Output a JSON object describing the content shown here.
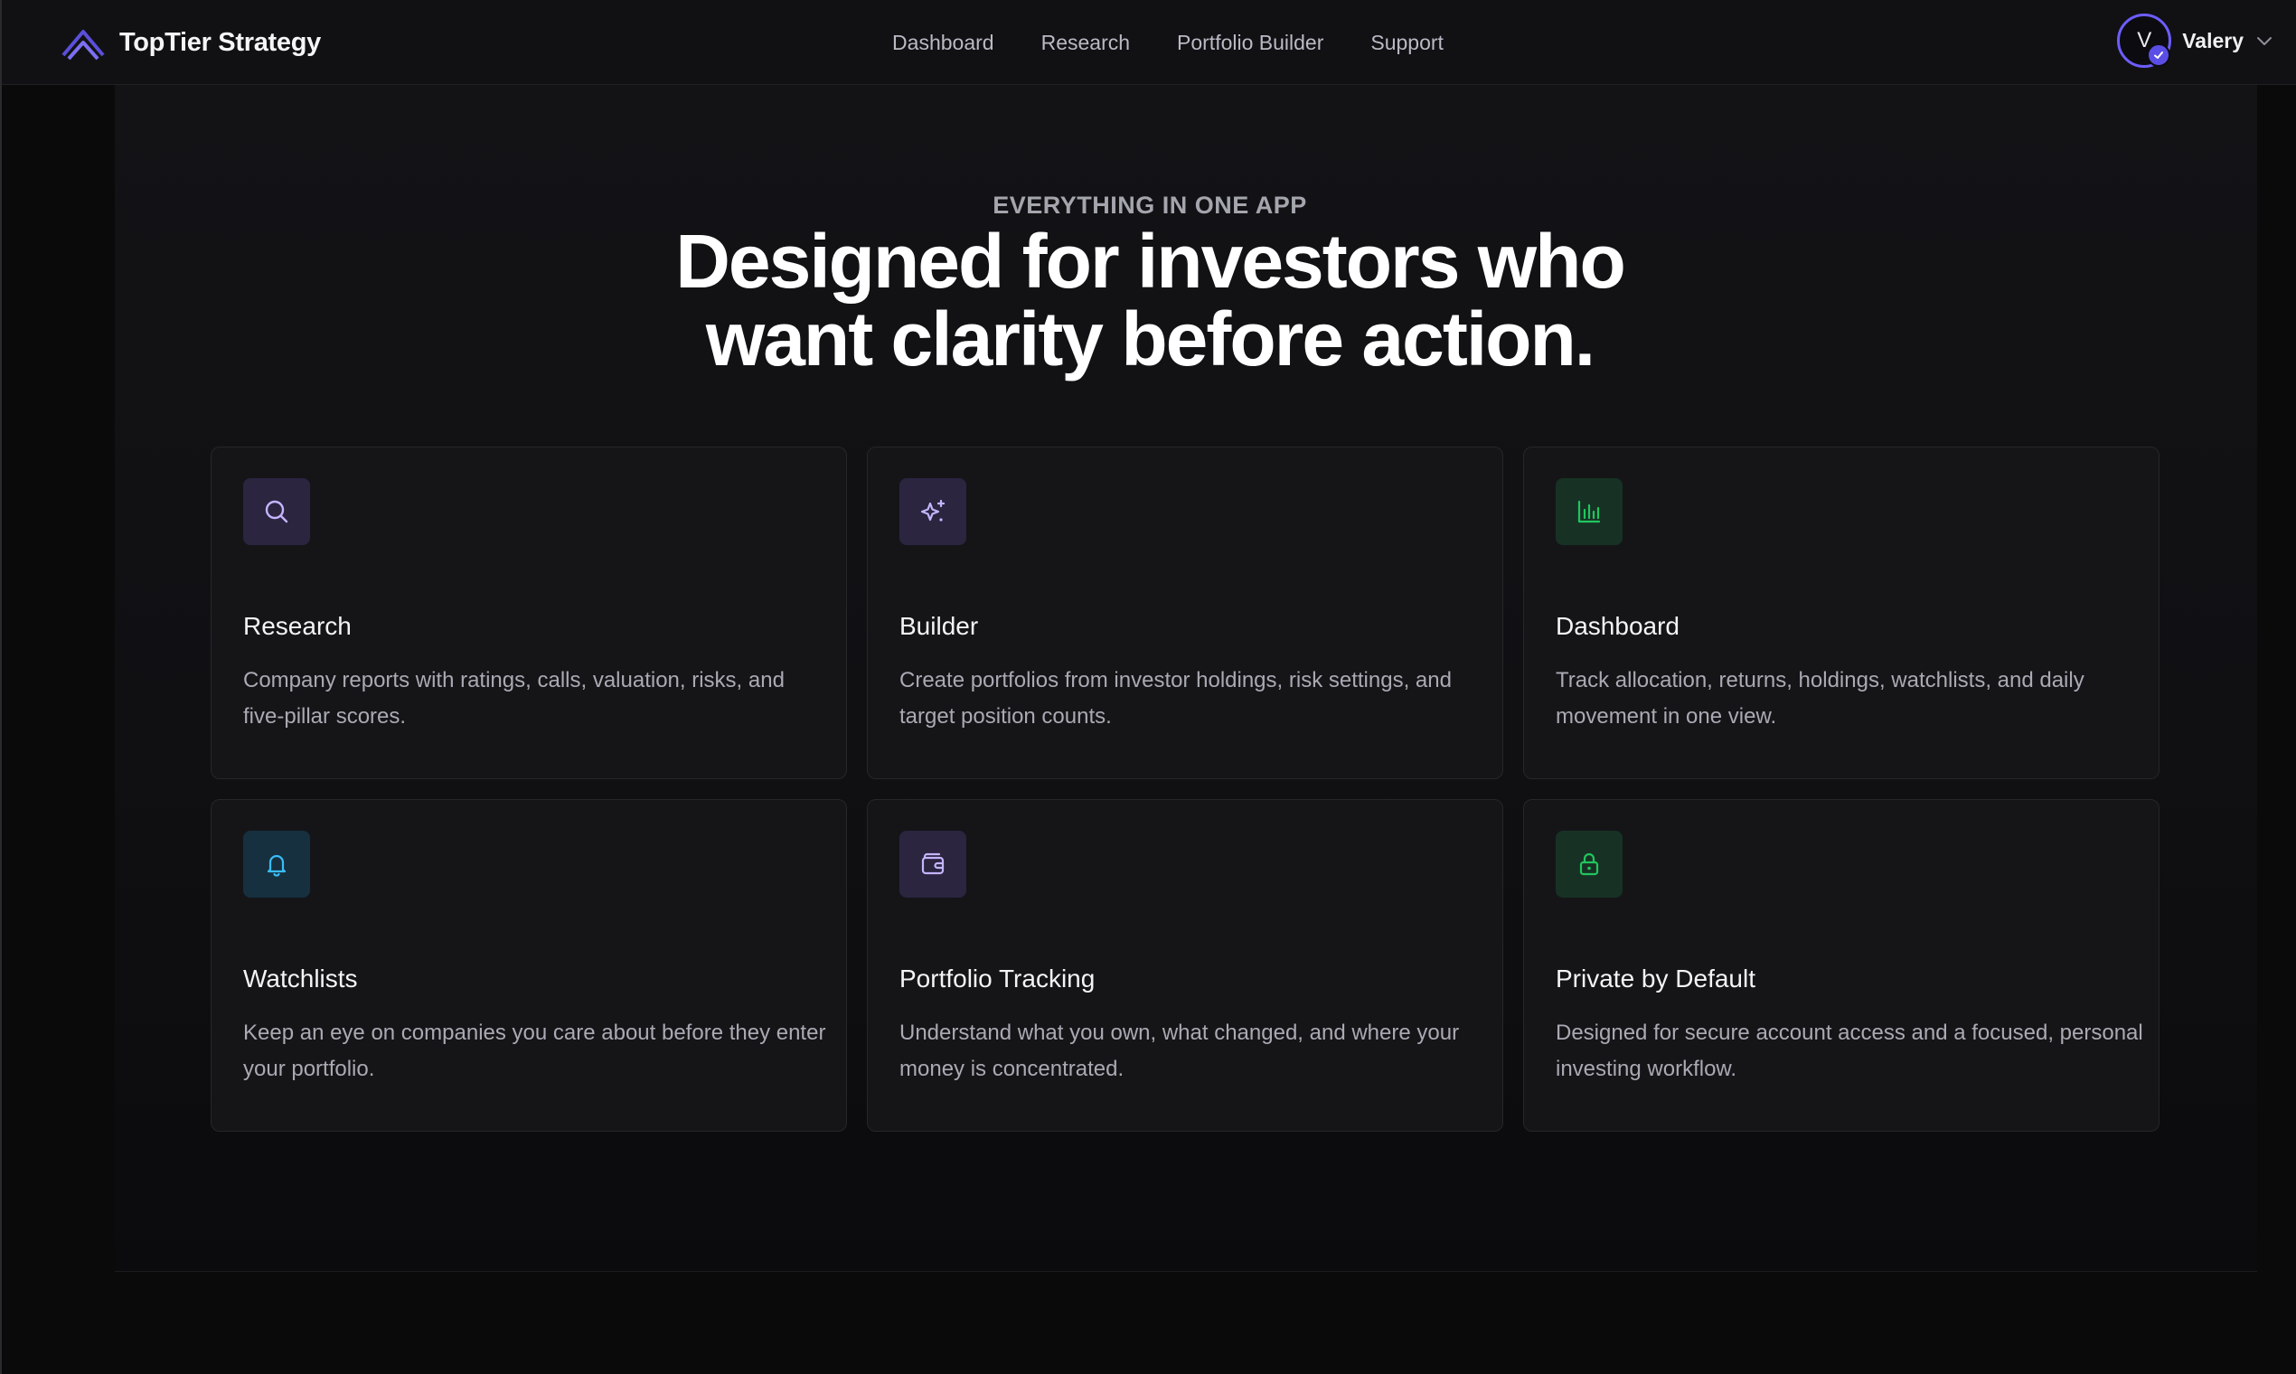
{
  "brand": {
    "name": "TopTier Strategy",
    "logo_icon": "chevron-stack-logo"
  },
  "nav": {
    "links": [
      "Dashboard",
      "Research",
      "Portfolio Builder",
      "Support"
    ]
  },
  "user": {
    "initial": "V",
    "name": "Valery",
    "badge_icon": "check-badge-icon",
    "menu_icon": "chevron-down-icon"
  },
  "hero": {
    "eyebrow": "EVERYTHING IN ONE APP",
    "headline_line1": "Designed for investors who",
    "headline_line2": "want clarity before action."
  },
  "colors": {
    "accent": "#6d5dfc",
    "icon_purple": "#a78bfa",
    "icon_green": "#22c55e",
    "icon_blue": "#38bdf8"
  },
  "features": [
    {
      "title": "Research",
      "icon": "search-icon",
      "description": "Company reports with ratings, calls, valuation, risks, and five-pillar scores."
    },
    {
      "title": "Builder",
      "icon": "sparkles-icon",
      "description": "Create portfolios from investor holdings, risk settings, and target position counts."
    },
    {
      "title": "Dashboard",
      "icon": "bar-chart-icon",
      "description": "Track allocation, returns, holdings, watchlists, and daily movement in one view."
    },
    {
      "title": "Watchlists",
      "icon": "bell-icon",
      "description": "Keep an eye on companies you care about before they enter your portfolio."
    },
    {
      "title": "Portfolio Tracking",
      "icon": "wallet-icon",
      "description": "Understand what you own, what changed, and where your money is concentrated."
    },
    {
      "title": "Private by Default",
      "icon": "lock-icon",
      "description": "Designed for secure account access and a focused, personal investing workflow."
    }
  ]
}
